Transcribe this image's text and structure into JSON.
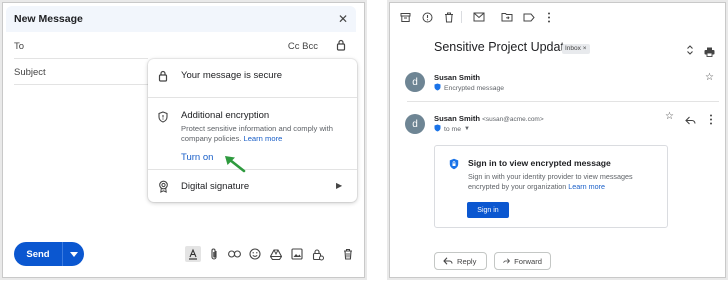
{
  "compose": {
    "title": "New Message",
    "close_icon": "close-icon",
    "to_label": "To",
    "cc_bcc_label": "Cc Bcc",
    "subject_placeholder": "Subject",
    "security_menu": {
      "secure_label": "Your message is secure",
      "additional_title": "Additional encryption",
      "additional_desc": "Protect sensitive information and comply with company policies.",
      "learn_more": "Learn more",
      "turn_on": "Turn on",
      "digital_signature": "Digital signature"
    },
    "send_label": "Send"
  },
  "email": {
    "subject": "Sensitive Project Update",
    "inbox_chip": "Inbox ×",
    "avatar_letter": "d",
    "message1": {
      "sender": "Susan Smith",
      "status": "Encrypted message"
    },
    "message2": {
      "sender": "Susan Smith",
      "sender_email": "<susan@acme.com>",
      "to_label": "to me"
    },
    "encrypted_card": {
      "title": "Sign in to view encrypted message",
      "desc": "Sign in with your identity provider to view messages encrypted by your organization",
      "learn_more": "Learn more",
      "signin_label": "Sign in"
    },
    "reply_label": "Reply",
    "forward_label": "Forward"
  },
  "colors": {
    "accent": "#0b57d0",
    "link": "#1a5fc8",
    "arrow": "#2e9a3e"
  }
}
